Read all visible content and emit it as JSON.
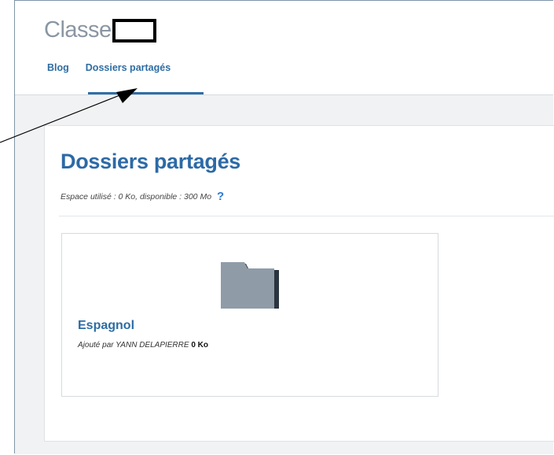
{
  "header": {
    "title": "Classe",
    "tabs": [
      {
        "label": "Blog",
        "active": false
      },
      {
        "label": "Dossiers partagés",
        "active": true
      }
    ]
  },
  "main": {
    "heading": "Dossiers partagés",
    "usage_text": "Espace utilisé : 0 Ko, disponible : 300 Mo",
    "help_label": "?",
    "folders": [
      {
        "name": "Espagnol",
        "added_by_prefix": "Ajouté par YANN DELAPIERRE",
        "size": "0 Ko",
        "icon": "folder-icon"
      }
    ]
  },
  "colors": {
    "accent": "#2e6da4",
    "heading": "#2c6aa6",
    "background": "#f1f2f3",
    "folder": "#8a9aa6"
  }
}
